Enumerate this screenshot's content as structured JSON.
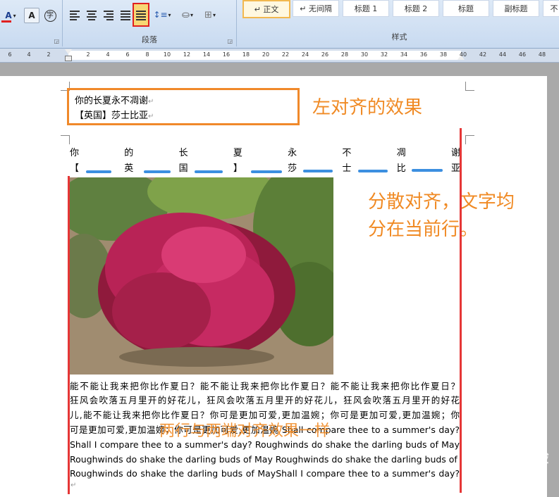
{
  "ribbon": {
    "font_group_buttons": [
      "A",
      "A",
      "字"
    ],
    "paragraph_group_label": "段落",
    "styles_group_label": "样式",
    "styles": [
      "↵ 正文",
      "↵ 无间隔",
      "标题 1",
      "标题 2",
      "标题",
      "副标题",
      "不"
    ],
    "selected_style_index": 0,
    "highlight_color": "#e02020"
  },
  "ruler": {
    "ticks": [
      "6",
      "4",
      "2",
      "2",
      "4",
      "6",
      "8",
      "10",
      "12",
      "14",
      "16",
      "18",
      "20",
      "22",
      "24",
      "26",
      "28",
      "30",
      "32",
      "34",
      "36",
      "38",
      "40",
      "42",
      "44",
      "46",
      "48"
    ]
  },
  "document": {
    "boxed_line1": "你的长夏永不凋谢",
    "boxed_line2": "【英国】莎士比亚",
    "spread_line1": [
      "你",
      "的",
      "长",
      "夏",
      "永",
      "不",
      "凋",
      "谢"
    ],
    "spread_line2": [
      "【",
      "英",
      "国",
      "】",
      "莎",
      "士",
      "比",
      "亚"
    ],
    "body_lines": [
      "能不能让我来把你比作夏日？能不能让我来把你比作夏日？能不能让我来把你比作夏日？",
      "狂风会吹落五月里开的好花儿，狂风会吹落五月里开的好花儿，狂风会吹落五月里开的好花",
      "儿,能不能让我来把你比作夏日？你可是更加可爱,更加温婉；你可是更加可爱,更加温婉；你",
      "可是更加可爱,更加温婉；你可是更加可爱,更加温婉 Shall compare thee to a summer's day?",
      "Shall I compare thee to a summer's day? Roughwinds do shake the darling buds of May",
      "Roughwinds do shake the darling buds of May Roughwinds do shake the darling buds of May",
      "Roughwinds do shake the darling buds of MayShall I compare thee to a summer's day?"
    ]
  },
  "annotations": {
    "left_align": "左对齐的效果",
    "distributed_line1": "分散对齐，文字均",
    "distributed_line2": "分在当前行。",
    "justify_note": "两行与两端对齐效果一样"
  },
  "watermark": "Bai 经验"
}
